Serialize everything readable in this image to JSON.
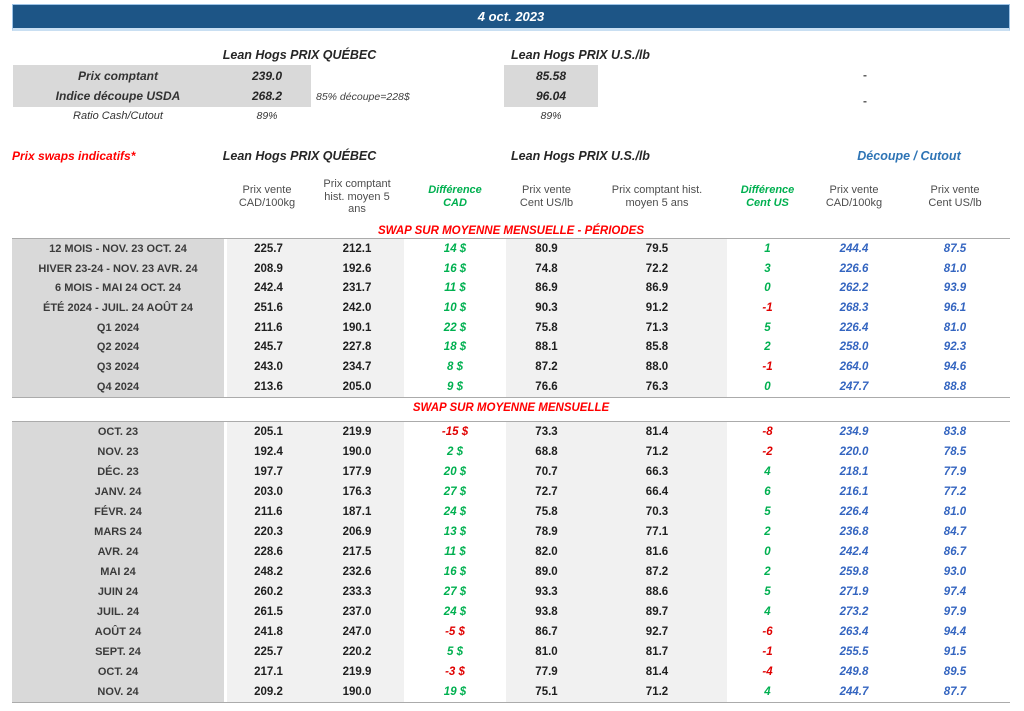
{
  "colors": {
    "banner_bg": "#1D5586",
    "title_red": "#FF0000",
    "diff_green": "#00B050",
    "diff_neg_red": "#E00000",
    "cutout_blue": "#3465C0",
    "label_gray": "#D9D9D9",
    "band_gray": "#F1F1F1"
  },
  "banner": {
    "date": "4 oct. 2023"
  },
  "top": {
    "quebec_header": "Lean Hogs PRIX QUÉBEC",
    "us_header": "Lean Hogs PRIX U.S./lb",
    "prix_comptant": {
      "label": "Prix comptant",
      "qc": "239.0",
      "us": "85.58",
      "dash": "-"
    },
    "indice": {
      "label": "Indice découpe USDA",
      "qc": "268.2",
      "note": "85% découpe=228$",
      "us": "96.04",
      "dash": "-"
    },
    "ratio": {
      "label": "Ratio Cash/Cutout",
      "qc": "89%",
      "us": "89%"
    }
  },
  "swap": {
    "title": "Prix swaps indicatifs*",
    "quebec_header": "Lean Hogs PRIX QUÉBEC",
    "us_header": "Lean Hogs PRIX U.S./lb",
    "cutout_header": "Découpe / Cutout",
    "columns": [
      {
        "text": "Prix vente\nCAD/100kg",
        "accent": ""
      },
      {
        "text": "Prix comptant\nhist. moyen 5\nans",
        "accent": ""
      },
      {
        "text": "Différence\nCAD",
        "accent": "green"
      },
      {
        "text": "Prix vente\nCent US/lb",
        "accent": ""
      },
      {
        "text": "Prix comptant hist.\nmoyen 5 ans",
        "accent": ""
      },
      {
        "text": "Différence\nCent US",
        "accent": "green"
      },
      {
        "text": "Prix vente\nCAD/100kg",
        "accent": ""
      },
      {
        "text": "Prix vente\nCent US/lb",
        "accent": ""
      }
    ],
    "sections": [
      {
        "title": "SWAP SUR MOYENNE MENSUELLE - PÉRIODES",
        "rows": [
          [
            "12 MOIS - NOV. 23 OCT. 24",
            "225.7",
            "212.1",
            "14 $",
            "80.9",
            "79.5",
            "1",
            "244.4",
            "87.5"
          ],
          [
            "HIVER 23-24 -  NOV. 23 AVR. 24",
            "208.9",
            "192.6",
            "16 $",
            "74.8",
            "72.2",
            "3",
            "226.6",
            "81.0"
          ],
          [
            "6 MOIS -  MAI 24 OCT. 24",
            "242.4",
            "231.7",
            "11 $",
            "86.9",
            "86.9",
            "0",
            "262.2",
            "93.9"
          ],
          [
            "ÉTÉ 2024 - JUIL. 24 AOÛT 24",
            "251.6",
            "242.0",
            "10 $",
            "90.3",
            "91.2",
            "-1",
            "268.3",
            "96.1"
          ],
          [
            "Q1 2024",
            "211.6",
            "190.1",
            "22 $",
            "75.8",
            "71.3",
            "5",
            "226.4",
            "81.0"
          ],
          [
            "Q2 2024",
            "245.7",
            "227.8",
            "18 $",
            "88.1",
            "85.8",
            "2",
            "258.0",
            "92.3"
          ],
          [
            "Q3 2024",
            "243.0",
            "234.7",
            "8 $",
            "87.2",
            "88.0",
            "-1",
            "264.0",
            "94.6"
          ],
          [
            "Q4 2024",
            "213.6",
            "205.0",
            "9 $",
            "76.6",
            "76.3",
            "0",
            "247.7",
            "88.8"
          ]
        ]
      },
      {
        "title": "SWAP SUR MOYENNE MENSUELLE",
        "rows": [
          [
            "OCT. 23",
            "205.1",
            "219.9",
            "-15 $",
            "73.3",
            "81.4",
            "-8",
            "234.9",
            "83.8"
          ],
          [
            "NOV. 23",
            "192.4",
            "190.0",
            "2 $",
            "68.8",
            "71.2",
            "-2",
            "220.0",
            "78.5"
          ],
          [
            "DÉC. 23",
            "197.7",
            "177.9",
            "20 $",
            "70.7",
            "66.3",
            "4",
            "218.1",
            "77.9"
          ],
          [
            "JANV. 24",
            "203.0",
            "176.3",
            "27 $",
            "72.7",
            "66.4",
            "6",
            "216.1",
            "77.2"
          ],
          [
            "FÉVR. 24",
            "211.6",
            "187.1",
            "24 $",
            "75.8",
            "70.3",
            "5",
            "226.4",
            "81.0"
          ],
          [
            "MARS 24",
            "220.3",
            "206.9",
            "13 $",
            "78.9",
            "77.1",
            "2",
            "236.8",
            "84.7"
          ],
          [
            "AVR. 24",
            "228.6",
            "217.5",
            "11 $",
            "82.0",
            "81.6",
            "0",
            "242.4",
            "86.7"
          ],
          [
            "MAI 24",
            "248.2",
            "232.6",
            "16 $",
            "89.0",
            "87.2",
            "2",
            "259.8",
            "93.0"
          ],
          [
            "JUIN 24",
            "260.2",
            "233.3",
            "27 $",
            "93.3",
            "88.6",
            "5",
            "271.9",
            "97.4"
          ],
          [
            "JUIL. 24",
            "261.5",
            "237.0",
            "24 $",
            "93.8",
            "89.7",
            "4",
            "273.2",
            "97.9"
          ],
          [
            "AOÛT 24",
            "241.8",
            "247.0",
            "-5 $",
            "86.7",
            "92.7",
            "-6",
            "263.4",
            "94.4"
          ],
          [
            "SEPT. 24",
            "225.7",
            "220.2",
            "5 $",
            "81.0",
            "81.7",
            "-1",
            "255.5",
            "91.5"
          ],
          [
            "OCT. 24",
            "217.1",
            "219.9",
            "-3 $",
            "77.9",
            "81.4",
            "-4",
            "249.8",
            "89.5"
          ],
          [
            "NOV. 24",
            "209.2",
            "190.0",
            "19 $",
            "75.1",
            "71.2",
            "4",
            "244.7",
            "87.7"
          ]
        ]
      }
    ]
  }
}
